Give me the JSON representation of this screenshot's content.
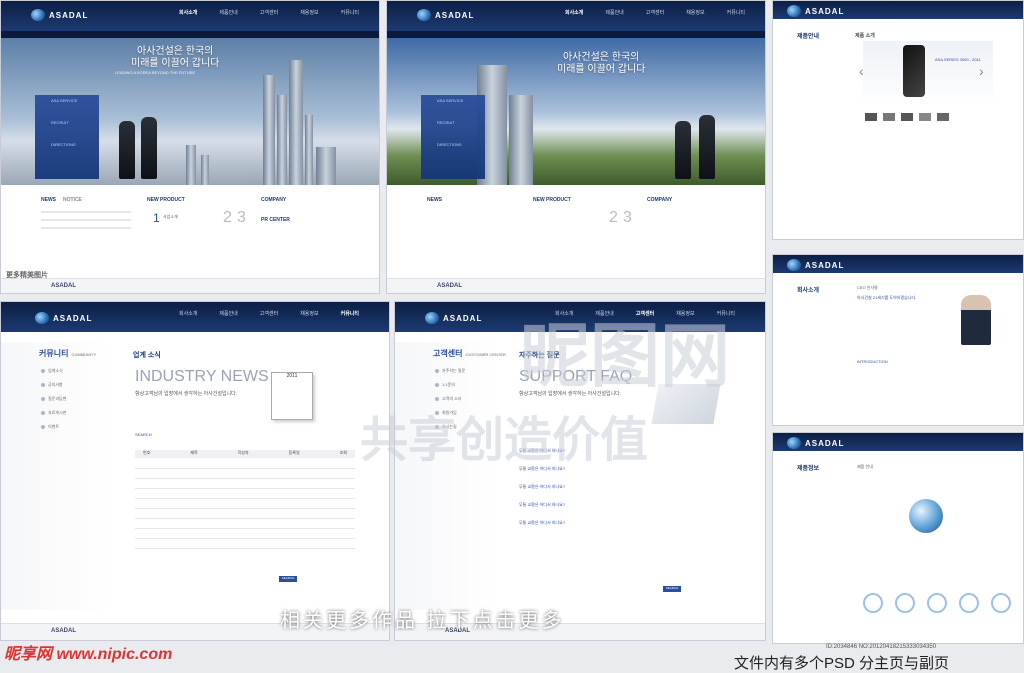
{
  "brand": {
    "logo": "ASADAL"
  },
  "nav": [
    "회사소개",
    "제품안내",
    "고객센터",
    "채용정보",
    "커뮤니티"
  ],
  "hero": {
    "line1": "아사건설은 한국의",
    "line2": "미래를 이끌어 갑니다",
    "sub": "LEADING A KOREA BEYOND THE FUTURE"
  },
  "services": [
    "ASA SERVICE",
    "RECRUIT",
    "DIRECTIONS"
  ],
  "home": {
    "news": "NEWS",
    "notice": "NOTICE",
    "new_product": "NEW PRODUCT",
    "company": "COMPANY",
    "pr_center": "PR CENTER",
    "product_nums": [
      "1",
      "2",
      "3"
    ],
    "product_first": "사업소개"
  },
  "product_page": {
    "side_title": "제품안내",
    "side_en": "PRODUCT",
    "page_title": "제품 소개",
    "caption": "ASA SERIES 3000 - 2011"
  },
  "community": {
    "side_title": "커뮤니티",
    "side_en": "COMMUNITY",
    "page_title": "업계 소식",
    "headline": "INDUSTRY NEWS",
    "intro": "항상고객님의 입장에서 생각하는 아사건설입니다.",
    "side": [
      "업계소식",
      "공지사항",
      "질문과답변",
      "자료게시판",
      "이벤트"
    ],
    "cols": [
      "번호",
      "제목",
      "작성자",
      "등록일",
      "조회"
    ],
    "search_label": "SEARCH",
    "calendar_year": "2011"
  },
  "support": {
    "side_title": "고객센터",
    "side_en": "CUSTOMER CENTER",
    "page_title": "자주하는 질문",
    "headline": "SUPPORT FAQ",
    "intro": "항상고객님의 입장에서 생각하는 아사건설입니다.",
    "side": [
      "자주하는 질문",
      "1:1문의",
      "고객의 소리",
      "회원가입",
      "오시는길"
    ],
    "faq_q": "무통 교환은 어디서 하나요?",
    "search_label": "SEARCH"
  },
  "ceo_page": {
    "side_title": "회사소개",
    "page_title": "CEO 인사말",
    "greeting": "아사건설 21세기를 도약하겠습니다.",
    "intro_label": "INTRODUCTION"
  },
  "product2": {
    "side_title": "제품정보",
    "page_title": "제품 안내"
  },
  "footer_brand": "ASADAL",
  "watermark": {
    "top": "昵图网",
    "mid": "共享创造价值",
    "side": "更多精美图片"
  },
  "banner": "相关更多作品 拉下点击更多",
  "site": "昵享网 www.nipic.com",
  "idline": "ID:2034846 NO:20120418215333034350",
  "caption": "文件内有多个PSD 分主页与副页"
}
